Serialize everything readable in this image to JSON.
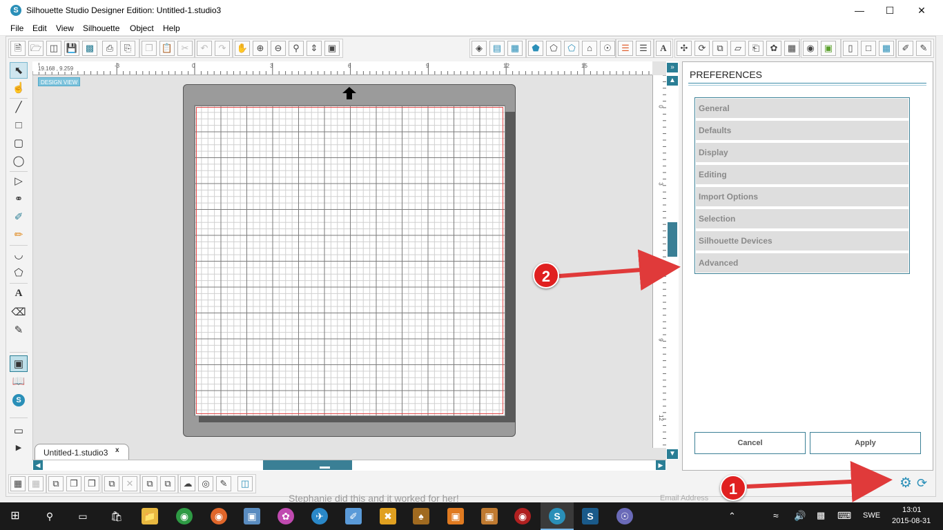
{
  "window": {
    "title": "Silhouette Studio Designer Edition: Untitled-1.studio3",
    "app_icon_letter": "S"
  },
  "menu": [
    "File",
    "Edit",
    "View",
    "Silhouette",
    "Object",
    "Help"
  ],
  "canvas": {
    "coords": "19.168 , 9.259",
    "design_view": "DESIGN VIEW",
    "ruler_h": [
      "-3",
      "0",
      "3",
      "6",
      "9",
      "12",
      "15"
    ],
    "ruler_v": [
      "0",
      "3",
      "6",
      "9",
      "12"
    ]
  },
  "doc_tab": {
    "label": "Untitled-1.studio3",
    "close": "x"
  },
  "preferences": {
    "title": "PREFERENCES",
    "items": [
      "General",
      "Defaults",
      "Display",
      "Editing",
      "Import Options",
      "Selection",
      "Silhouette Devices",
      "Advanced"
    ],
    "cancel": "Cancel",
    "apply": "Apply"
  },
  "annotations": {
    "one": "1",
    "two": "2",
    "color": "#e03a3a"
  },
  "background_page": {
    "text": "Stephanie did this and it worked for her!",
    "input_placeholder": "Email Address"
  },
  "taskbar": {
    "language": "SWE",
    "time": "13:01",
    "date": "2015-08-31"
  },
  "colors": {
    "accent": "#2a7e95",
    "cut_line": "#e04444",
    "mat": "#9b9b9b"
  }
}
